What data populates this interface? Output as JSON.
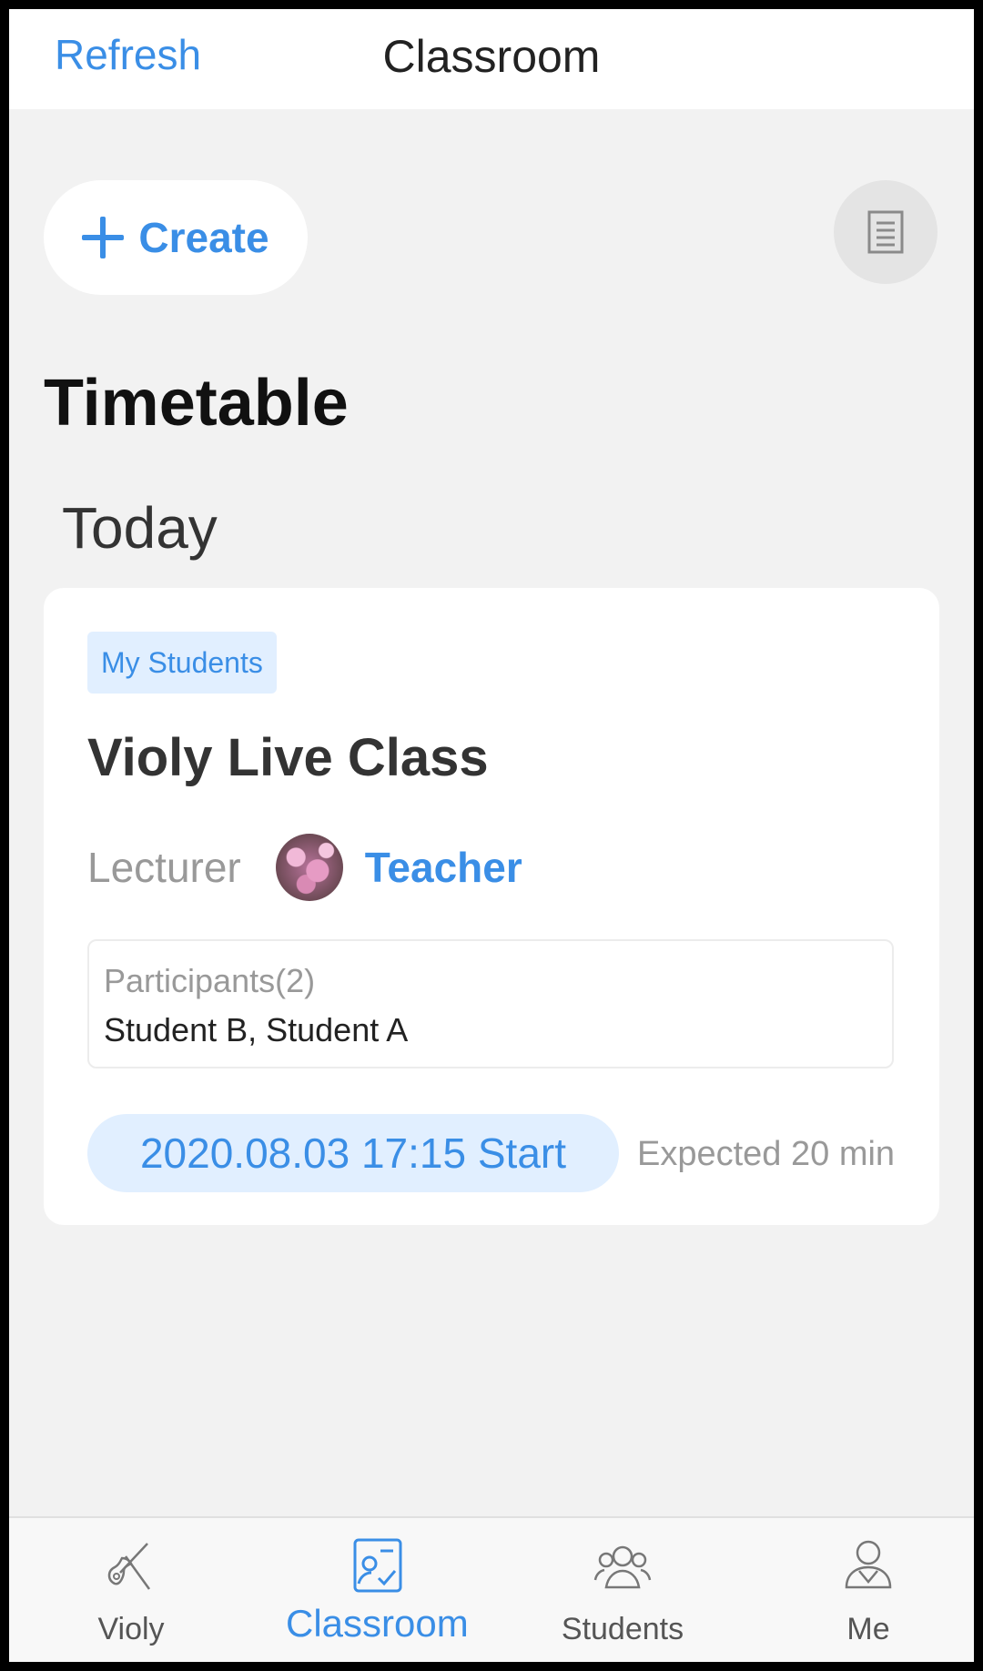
{
  "header": {
    "refresh_label": "Refresh",
    "title": "Classroom"
  },
  "actions": {
    "create_label": "Create",
    "list_icon": "document-list-icon"
  },
  "timetable": {
    "title": "Timetable",
    "section": "Today",
    "card": {
      "tag": "My Students",
      "class_name": "Violy Live Class",
      "lecturer_label": "Lecturer",
      "lecturer_name": "Teacher",
      "participants_label": "Participants(2)",
      "participants": "Student B, Student A",
      "start": "2020.08.03 17:15 Start",
      "duration": "Expected 20 min"
    }
  },
  "bottom_nav": {
    "items": [
      {
        "label": "Violy",
        "icon": "violin-icon"
      },
      {
        "label": "Classroom",
        "icon": "classroom-icon",
        "active": true
      },
      {
        "label": "Students",
        "icon": "students-icon"
      },
      {
        "label": "Me",
        "icon": "user-icon"
      }
    ]
  },
  "colors": {
    "accent": "#3a8ee6",
    "background": "#f2f2f2",
    "tag_bg": "#e1efff"
  }
}
